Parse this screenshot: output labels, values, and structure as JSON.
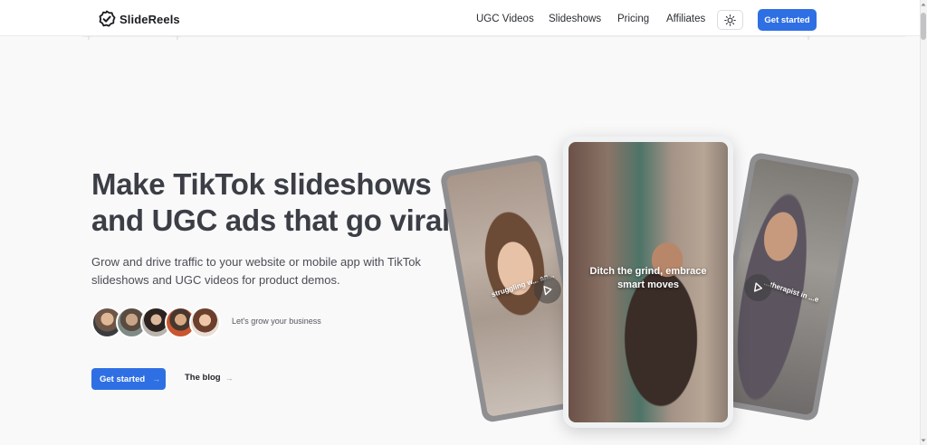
{
  "brand": {
    "name": "SlideReels"
  },
  "nav": {
    "items": [
      {
        "label": "UGC Videos"
      },
      {
        "label": "Slideshows"
      },
      {
        "label": "Pricing"
      },
      {
        "label": "Affiliates"
      }
    ],
    "theme_icon": "sun-icon",
    "cta_label": "Get started"
  },
  "hero": {
    "headline": "Make TikTok slideshows and UGC ads that go viral",
    "subheadline": "Grow and drive traffic to your website or mobile app with TikTok slideshows and UGC videos for product demos.",
    "avatar_caption": "Let's grow your business",
    "primary_cta": "Get started",
    "secondary_cta": "The blog"
  },
  "cards": {
    "left_caption": "struggling w... an...",
    "center_caption": "Ditch the grind, embrace smart moves",
    "right_caption": "...therapist in ...e"
  },
  "colors": {
    "accent": "#2f6fe4",
    "headline": "#3c3e46",
    "background": "#f9f9fa"
  }
}
